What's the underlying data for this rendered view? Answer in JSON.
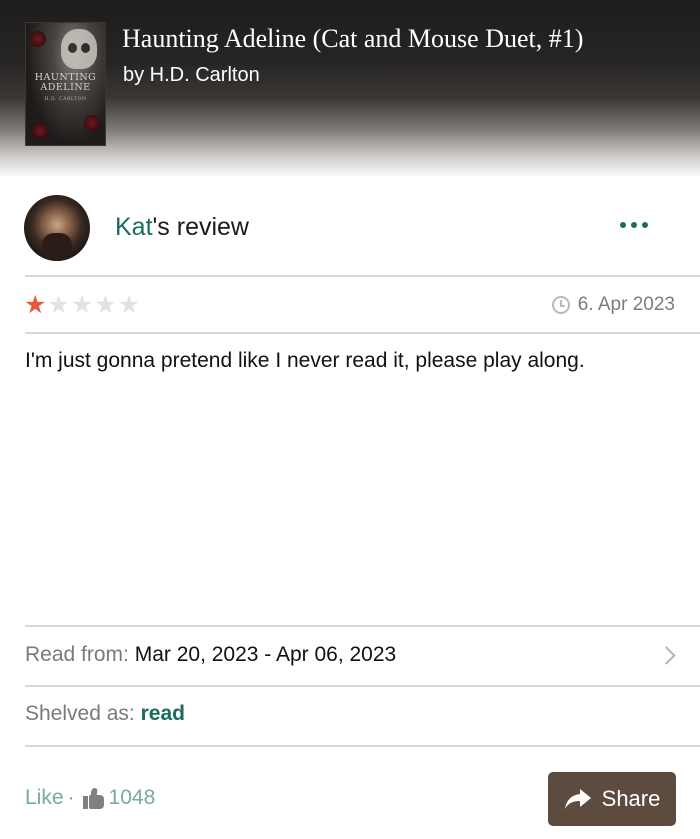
{
  "book": {
    "title": "Haunting Adeline (Cat and Mouse Duet, #1)",
    "author": "by H.D. Carlton",
    "cover_title_line1": "HAUNTING",
    "cover_title_line2": "ADELINE",
    "cover_author": "H.D. CARLTON"
  },
  "review": {
    "reviewer_name": "Kat",
    "heading_suffix": "'s review",
    "rating": 1,
    "rating_max": 5,
    "date": "6. Apr 2023",
    "text": "I'm just gonna pretend like I never read it, please play along."
  },
  "reading": {
    "read_label": "Read from:",
    "read_value": "Mar 20, 2023 - Apr 06, 2023",
    "shelved_label": "Shelved as:",
    "shelved_value": "read"
  },
  "actions": {
    "like_label": "Like",
    "separator": "·",
    "like_count": "1048",
    "share_label": "Share"
  },
  "colors": {
    "accent_teal": "#1b6a60",
    "star_filled": "#e8573f",
    "share_bg": "#5d4b3f"
  },
  "icons": [
    "more-options-icon",
    "clock-icon",
    "chevron-right-icon",
    "thumbs-up-icon",
    "share-arrow-icon"
  ]
}
